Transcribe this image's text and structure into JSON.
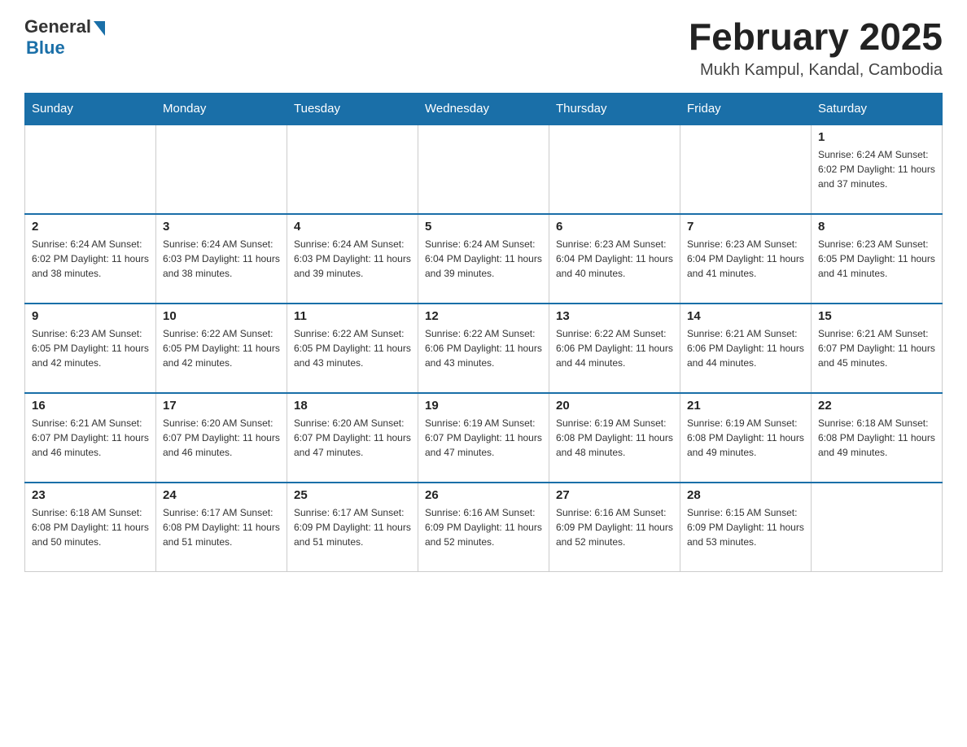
{
  "header": {
    "logo": {
      "general": "General",
      "blue": "Blue"
    },
    "title": "February 2025",
    "location": "Mukh Kampul, Kandal, Cambodia"
  },
  "days_of_week": [
    "Sunday",
    "Monday",
    "Tuesday",
    "Wednesday",
    "Thursday",
    "Friday",
    "Saturday"
  ],
  "weeks": [
    [
      {
        "day": "",
        "info": ""
      },
      {
        "day": "",
        "info": ""
      },
      {
        "day": "",
        "info": ""
      },
      {
        "day": "",
        "info": ""
      },
      {
        "day": "",
        "info": ""
      },
      {
        "day": "",
        "info": ""
      },
      {
        "day": "1",
        "info": "Sunrise: 6:24 AM\nSunset: 6:02 PM\nDaylight: 11 hours and 37 minutes."
      }
    ],
    [
      {
        "day": "2",
        "info": "Sunrise: 6:24 AM\nSunset: 6:02 PM\nDaylight: 11 hours and 38 minutes."
      },
      {
        "day": "3",
        "info": "Sunrise: 6:24 AM\nSunset: 6:03 PM\nDaylight: 11 hours and 38 minutes."
      },
      {
        "day": "4",
        "info": "Sunrise: 6:24 AM\nSunset: 6:03 PM\nDaylight: 11 hours and 39 minutes."
      },
      {
        "day": "5",
        "info": "Sunrise: 6:24 AM\nSunset: 6:04 PM\nDaylight: 11 hours and 39 minutes."
      },
      {
        "day": "6",
        "info": "Sunrise: 6:23 AM\nSunset: 6:04 PM\nDaylight: 11 hours and 40 minutes."
      },
      {
        "day": "7",
        "info": "Sunrise: 6:23 AM\nSunset: 6:04 PM\nDaylight: 11 hours and 41 minutes."
      },
      {
        "day": "8",
        "info": "Sunrise: 6:23 AM\nSunset: 6:05 PM\nDaylight: 11 hours and 41 minutes."
      }
    ],
    [
      {
        "day": "9",
        "info": "Sunrise: 6:23 AM\nSunset: 6:05 PM\nDaylight: 11 hours and 42 minutes."
      },
      {
        "day": "10",
        "info": "Sunrise: 6:22 AM\nSunset: 6:05 PM\nDaylight: 11 hours and 42 minutes."
      },
      {
        "day": "11",
        "info": "Sunrise: 6:22 AM\nSunset: 6:05 PM\nDaylight: 11 hours and 43 minutes."
      },
      {
        "day": "12",
        "info": "Sunrise: 6:22 AM\nSunset: 6:06 PM\nDaylight: 11 hours and 43 minutes."
      },
      {
        "day": "13",
        "info": "Sunrise: 6:22 AM\nSunset: 6:06 PM\nDaylight: 11 hours and 44 minutes."
      },
      {
        "day": "14",
        "info": "Sunrise: 6:21 AM\nSunset: 6:06 PM\nDaylight: 11 hours and 44 minutes."
      },
      {
        "day": "15",
        "info": "Sunrise: 6:21 AM\nSunset: 6:07 PM\nDaylight: 11 hours and 45 minutes."
      }
    ],
    [
      {
        "day": "16",
        "info": "Sunrise: 6:21 AM\nSunset: 6:07 PM\nDaylight: 11 hours and 46 minutes."
      },
      {
        "day": "17",
        "info": "Sunrise: 6:20 AM\nSunset: 6:07 PM\nDaylight: 11 hours and 46 minutes."
      },
      {
        "day": "18",
        "info": "Sunrise: 6:20 AM\nSunset: 6:07 PM\nDaylight: 11 hours and 47 minutes."
      },
      {
        "day": "19",
        "info": "Sunrise: 6:19 AM\nSunset: 6:07 PM\nDaylight: 11 hours and 47 minutes."
      },
      {
        "day": "20",
        "info": "Sunrise: 6:19 AM\nSunset: 6:08 PM\nDaylight: 11 hours and 48 minutes."
      },
      {
        "day": "21",
        "info": "Sunrise: 6:19 AM\nSunset: 6:08 PM\nDaylight: 11 hours and 49 minutes."
      },
      {
        "day": "22",
        "info": "Sunrise: 6:18 AM\nSunset: 6:08 PM\nDaylight: 11 hours and 49 minutes."
      }
    ],
    [
      {
        "day": "23",
        "info": "Sunrise: 6:18 AM\nSunset: 6:08 PM\nDaylight: 11 hours and 50 minutes."
      },
      {
        "day": "24",
        "info": "Sunrise: 6:17 AM\nSunset: 6:08 PM\nDaylight: 11 hours and 51 minutes."
      },
      {
        "day": "25",
        "info": "Sunrise: 6:17 AM\nSunset: 6:09 PM\nDaylight: 11 hours and 51 minutes."
      },
      {
        "day": "26",
        "info": "Sunrise: 6:16 AM\nSunset: 6:09 PM\nDaylight: 11 hours and 52 minutes."
      },
      {
        "day": "27",
        "info": "Sunrise: 6:16 AM\nSunset: 6:09 PM\nDaylight: 11 hours and 52 minutes."
      },
      {
        "day": "28",
        "info": "Sunrise: 6:15 AM\nSunset: 6:09 PM\nDaylight: 11 hours and 53 minutes."
      },
      {
        "day": "",
        "info": ""
      }
    ]
  ]
}
